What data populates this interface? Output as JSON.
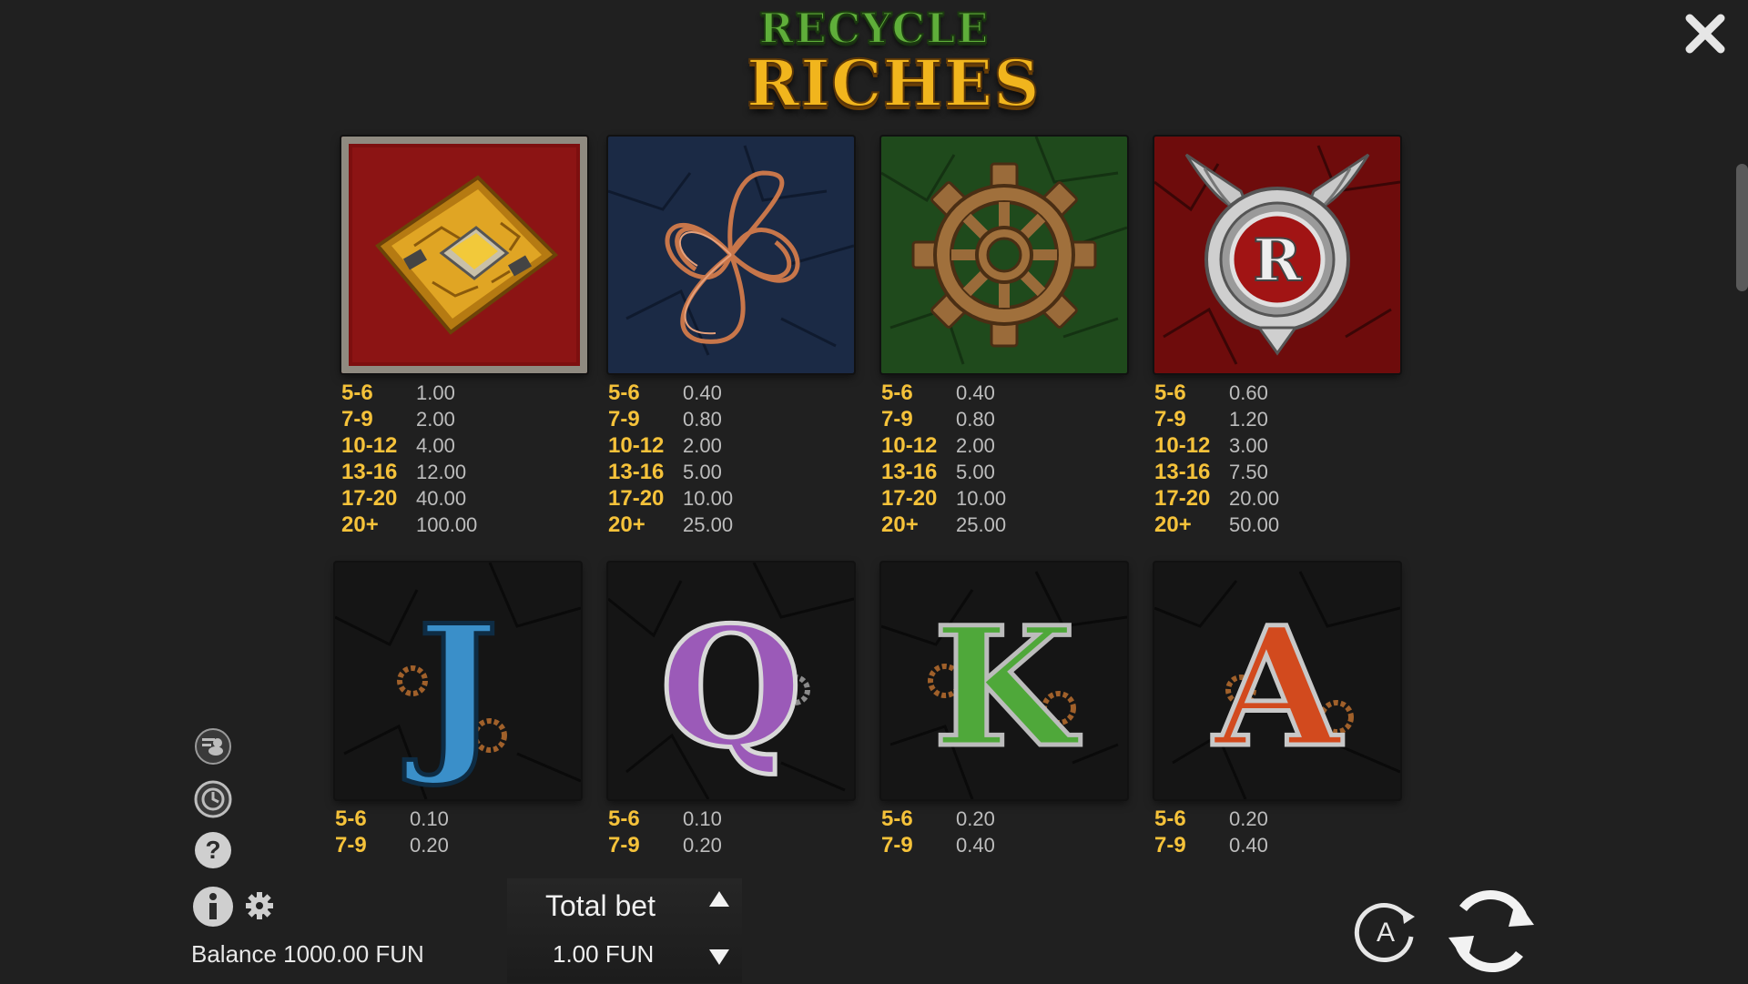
{
  "logo": {
    "line1": "RECYCLE",
    "line2": "RICHES"
  },
  "close": {
    "icon": "close-icon"
  },
  "paytable": {
    "symbols": [
      {
        "name": "circuit-board",
        "icon": "circuit-board-icon",
        "bg": "#8a1010",
        "pays": [
          {
            "range": "5-6",
            "amount": "1.00"
          },
          {
            "range": "7-9",
            "amount": "2.00"
          },
          {
            "range": "10-12",
            "amount": "4.00"
          },
          {
            "range": "13-16",
            "amount": "12.00"
          },
          {
            "range": "17-20",
            "amount": "40.00"
          },
          {
            "range": "20+",
            "amount": "100.00"
          }
        ]
      },
      {
        "name": "copper-wire",
        "icon": "copper-wire-icon",
        "bg": "#1b2a45",
        "pays": [
          {
            "range": "5-6",
            "amount": "0.40"
          },
          {
            "range": "7-9",
            "amount": "0.80"
          },
          {
            "range": "10-12",
            "amount": "2.00"
          },
          {
            "range": "13-16",
            "amount": "5.00"
          },
          {
            "range": "17-20",
            "amount": "10.00"
          },
          {
            "range": "20+",
            "amount": "25.00"
          }
        ]
      },
      {
        "name": "gear",
        "icon": "gear-symbol-icon",
        "bg": "#1f4a1c",
        "pays": [
          {
            "range": "5-6",
            "amount": "0.40"
          },
          {
            "range": "7-9",
            "amount": "0.80"
          },
          {
            "range": "10-12",
            "amount": "2.00"
          },
          {
            "range": "13-16",
            "amount": "5.00"
          },
          {
            "range": "17-20",
            "amount": "10.00"
          },
          {
            "range": "20+",
            "amount": "25.00"
          }
        ]
      },
      {
        "name": "winged-r-badge",
        "icon": "winged-r-badge-icon",
        "bg": "#6e0c0c",
        "letter": "R",
        "pays": [
          {
            "range": "5-6",
            "amount": "0.60"
          },
          {
            "range": "7-9",
            "amount": "1.20"
          },
          {
            "range": "10-12",
            "amount": "3.00"
          },
          {
            "range": "13-16",
            "amount": "7.50"
          },
          {
            "range": "17-20",
            "amount": "20.00"
          },
          {
            "range": "20+",
            "amount": "50.00"
          }
        ]
      },
      {
        "name": "letter-j",
        "icon": "letter-j-icon",
        "letter": "J",
        "color": "#3a8fc9",
        "pays": [
          {
            "range": "5-6",
            "amount": "0.10"
          },
          {
            "range": "7-9",
            "amount": "0.20"
          }
        ]
      },
      {
        "name": "letter-q",
        "icon": "letter-q-icon",
        "letter": "Q",
        "color": "#9b5ab8",
        "pays": [
          {
            "range": "5-6",
            "amount": "0.10"
          },
          {
            "range": "7-9",
            "amount": "0.20"
          }
        ]
      },
      {
        "name": "letter-k",
        "icon": "letter-k-icon",
        "letter": "K",
        "color": "#4fa83a",
        "pays": [
          {
            "range": "5-6",
            "amount": "0.20"
          },
          {
            "range": "7-9",
            "amount": "0.40"
          }
        ]
      },
      {
        "name": "letter-a",
        "icon": "letter-a-icon",
        "letter": "A",
        "color": "#d24a1e",
        "pays": [
          {
            "range": "5-6",
            "amount": "0.20"
          },
          {
            "range": "7-9",
            "amount": "0.40"
          }
        ]
      }
    ]
  },
  "side_menu": [
    {
      "icon": "paytable-coins-icon"
    },
    {
      "icon": "history-icon"
    },
    {
      "icon": "help-icon"
    },
    {
      "icon": "info-icon"
    }
  ],
  "settings": {
    "icon": "settings-gear-icon"
  },
  "balance": {
    "text": "Balance 1000.00 FUN"
  },
  "bet": {
    "label": "Total bet",
    "value": "1.00 FUN"
  },
  "controls": {
    "autoplay_icon": "autoplay-icon",
    "autoplay_letter": "A",
    "spin_icon": "spin-icon"
  },
  "colors": {
    "range": "#f5c23a",
    "amount": "#bdbdbd",
    "background": "#202020"
  }
}
